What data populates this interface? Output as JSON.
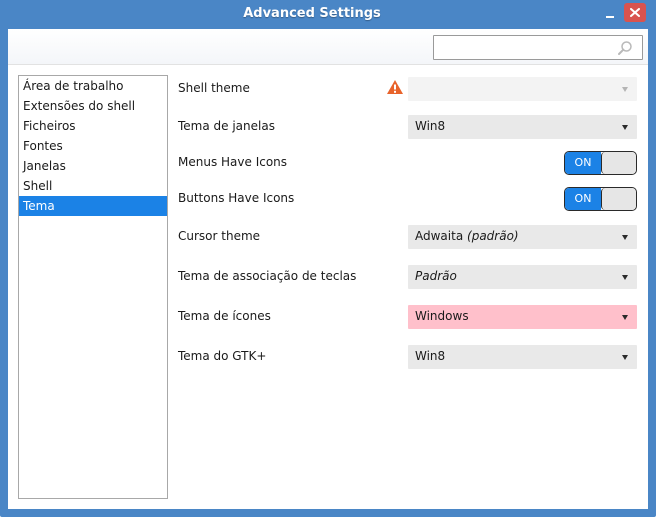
{
  "window": {
    "title": "Advanced Settings"
  },
  "search": {
    "value": "",
    "placeholder": ""
  },
  "sidebar": {
    "items": [
      {
        "label": "Área de trabalho"
      },
      {
        "label": "Extensões do shell"
      },
      {
        "label": "Ficheiros"
      },
      {
        "label": "Fontes"
      },
      {
        "label": "Janelas"
      },
      {
        "label": "Shell"
      },
      {
        "label": "Tema"
      }
    ],
    "selected": "Tema"
  },
  "settings": {
    "shell_theme": {
      "label": "Shell theme",
      "value": "",
      "status": "warning-icon"
    },
    "window_theme": {
      "label": "Tema de janelas",
      "value": "Win8"
    },
    "menus_have_icons": {
      "label": "Menus Have Icons",
      "state": "ON"
    },
    "buttons_have_icons": {
      "label": "Buttons Have Icons",
      "state": "ON"
    },
    "cursor_theme": {
      "label": "Cursor theme",
      "value": "Adwaita",
      "suffix": "(padrão)"
    },
    "key_theme": {
      "label": "Tema de associação de teclas",
      "value": "Padrão"
    },
    "icon_theme": {
      "label": "Tema de ícones",
      "value": "Windows"
    },
    "gtk_theme": {
      "label": "Tema do GTK+",
      "value": "Win8"
    }
  },
  "colors": {
    "titlebar": "#4a86c6",
    "accent": "#1b82e6",
    "close": "#d9534f",
    "error_field": "#ffc0cb",
    "warning": "#e8632b"
  }
}
